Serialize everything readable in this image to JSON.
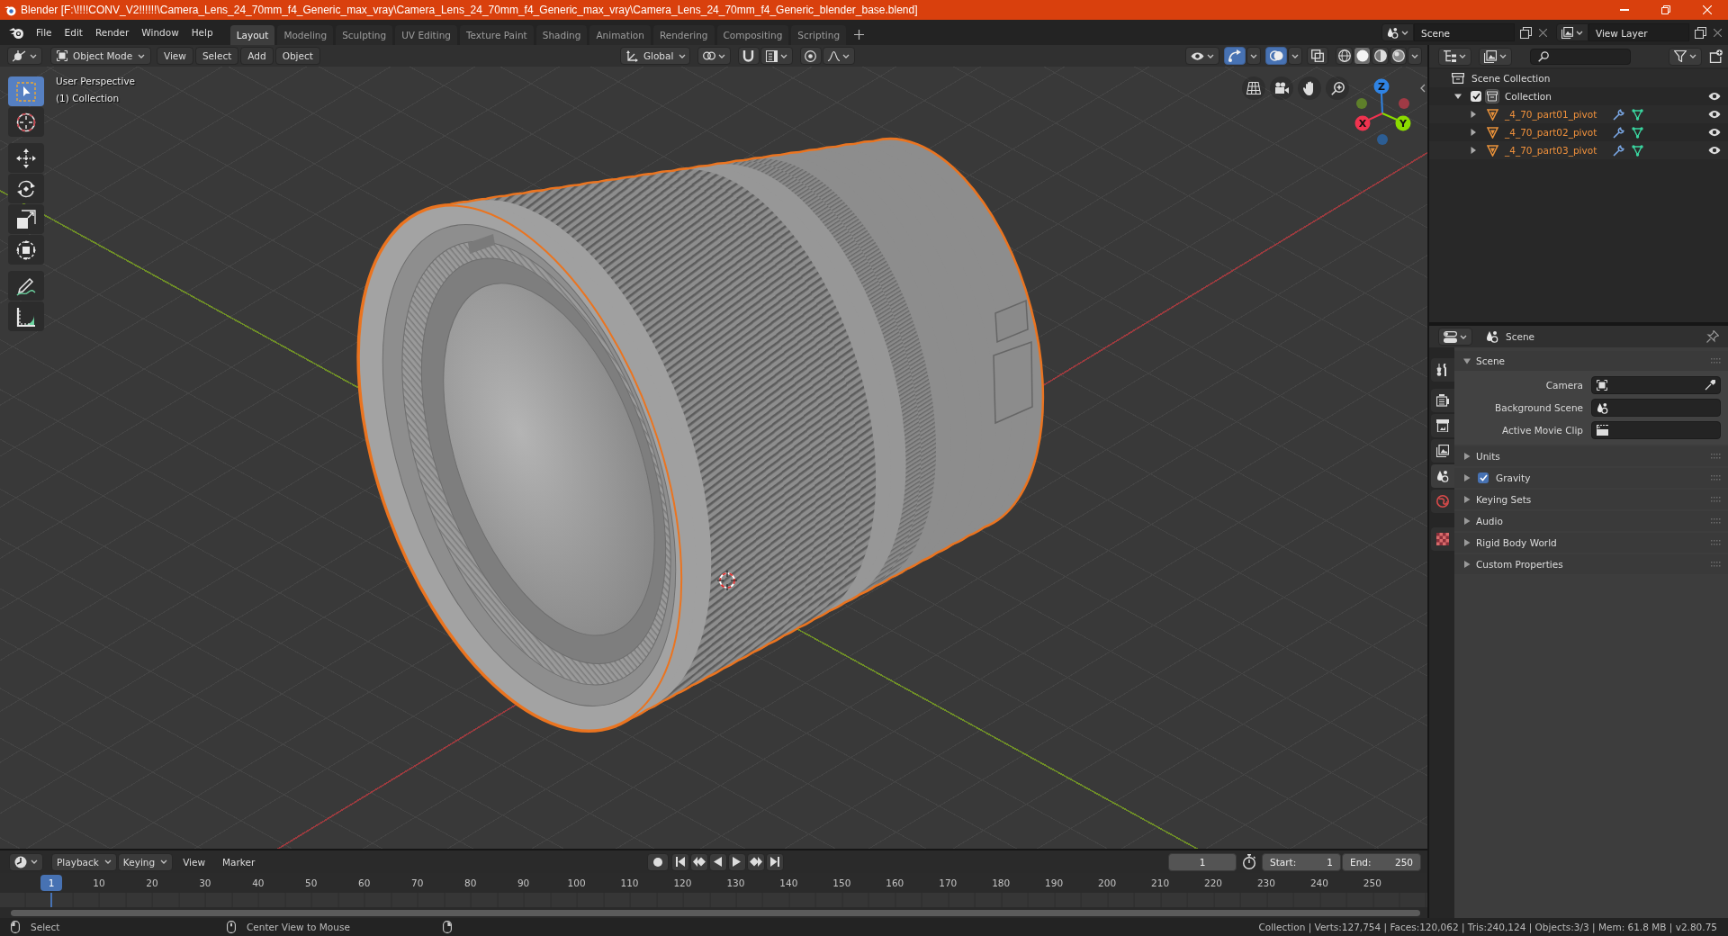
{
  "window": {
    "title": "Blender [F:\\!!!!CONV_V2!!!!!!\\Camera_Lens_24_70mm_f4_Generic_max_vray\\Camera_Lens_24_70mm_f4_Generic_max_vray\\Camera_Lens_24_70mm_f4_Generic_blender_base.blend]"
  },
  "menu": [
    "File",
    "Edit",
    "Render",
    "Window",
    "Help"
  ],
  "workspaces": [
    {
      "label": "Layout",
      "selected": true
    },
    {
      "label": "Modeling",
      "selected": false
    },
    {
      "label": "Sculpting",
      "selected": false
    },
    {
      "label": "UV Editing",
      "selected": false
    },
    {
      "label": "Texture Paint",
      "selected": false
    },
    {
      "label": "Shading",
      "selected": false
    },
    {
      "label": "Animation",
      "selected": false
    },
    {
      "label": "Rendering",
      "selected": false
    },
    {
      "label": "Compositing",
      "selected": false
    },
    {
      "label": "Scripting",
      "selected": false
    }
  ],
  "scene": {
    "label": "Scene"
  },
  "view_layer": {
    "label": "View Layer"
  },
  "viewport": {
    "header": {
      "mode": "Object Mode",
      "menus": [
        "View",
        "Select",
        "Add",
        "Object"
      ],
      "orientation": "Global",
      "toggles": [
        {
          "kind": "gizmos",
          "on": true
        },
        {
          "kind": "overlays",
          "on": true
        },
        {
          "kind": "xray",
          "on": false
        }
      ],
      "shading": [
        {
          "kind": "wireframe",
          "selected": false
        },
        {
          "kind": "solid",
          "selected": true
        },
        {
          "kind": "material",
          "selected": false
        },
        {
          "kind": "rendered",
          "selected": false
        }
      ]
    },
    "info": [
      "User Perspective",
      "(1) Collection"
    ],
    "tool_groups": [
      {
        "tools": [
          {
            "kind": "select_box",
            "selected": true
          },
          {
            "kind": "cursor",
            "selected": false
          }
        ]
      },
      {
        "tools": [
          {
            "kind": "move",
            "selected": false
          },
          {
            "kind": "rotate",
            "selected": false
          },
          {
            "kind": "scale",
            "selected": false
          },
          {
            "kind": "transform",
            "selected": false
          }
        ]
      },
      {
        "tools": [
          {
            "kind": "annotate",
            "selected": false
          },
          {
            "kind": "measure",
            "selected": false
          }
        ]
      }
    ],
    "axes": [
      {
        "kind": "z",
        "label": "Z"
      },
      {
        "kind": "x",
        "label": "X"
      },
      {
        "kind": "y",
        "label": "Y"
      }
    ]
  },
  "outliner": {
    "root": "Scene Collection",
    "collections": [
      {
        "label": "Collection",
        "checked": true,
        "expanded": true,
        "visible": true,
        "children": [
          {
            "label": "_4_70_part01_pivot",
            "expanded": false,
            "selected": true,
            "visible": true
          },
          {
            "label": "_4_70_part02_pivot",
            "expanded": false,
            "selected": true,
            "visible": true
          },
          {
            "label": "_4_70_part03_pivot",
            "expanded": false,
            "selected": true,
            "visible": true
          }
        ]
      }
    ]
  },
  "properties": {
    "context": "Scene",
    "tab_groups": [
      {
        "tabs": [
          {
            "kind": "tool",
            "selected": false
          }
        ]
      },
      {
        "tabs": [
          {
            "kind": "render",
            "selected": false
          },
          {
            "kind": "output",
            "selected": false
          },
          {
            "kind": "view_layer",
            "selected": false
          },
          {
            "kind": "scene",
            "selected": true
          },
          {
            "kind": "world",
            "selected": false
          }
        ]
      },
      {
        "tabs": [
          {
            "kind": "texture",
            "selected": false
          }
        ]
      }
    ],
    "panels": [
      {
        "kind": "plain",
        "title": "Scene",
        "expanded": true,
        "fields": [
          {
            "kind": "object",
            "label": "Camera"
          },
          {
            "kind": "scene",
            "label": "Background Scene"
          },
          {
            "kind": "clip",
            "label": "Active Movie Clip"
          }
        ]
      },
      {
        "kind": "plain",
        "title": "Units",
        "expanded": false
      },
      {
        "kind": "toggle",
        "title": "Gravity",
        "expanded": false,
        "checked": true
      },
      {
        "kind": "plain",
        "title": "Keying Sets",
        "expanded": false
      },
      {
        "kind": "plain",
        "title": "Audio",
        "expanded": false
      },
      {
        "kind": "plain",
        "title": "Rigid Body World",
        "expanded": false
      },
      {
        "kind": "plain",
        "title": "Custom Properties",
        "expanded": false
      }
    ]
  },
  "timeline": {
    "menus": [
      {
        "kind": "dropdown",
        "label": "Playback"
      },
      {
        "kind": "dropdown",
        "label": "Keying"
      },
      {
        "kind": "menu",
        "label": "View"
      },
      {
        "kind": "menu",
        "label": "Marker"
      }
    ],
    "current_frame": "1",
    "start_label": "Start:",
    "start": "1",
    "end_label": "End:",
    "end": "250",
    "playhead": "1",
    "ruler": [
      "10",
      "20",
      "30",
      "40",
      "50",
      "60",
      "70",
      "80",
      "90",
      "100",
      "110",
      "120",
      "130",
      "140",
      "150",
      "160",
      "170",
      "180",
      "190",
      "200",
      "210",
      "220",
      "230",
      "240",
      "250"
    ]
  },
  "status_bar": {
    "hints": [
      {
        "kind": "mouse_left",
        "label": "Select"
      },
      {
        "kind": "mouse_middle",
        "label": "Center View to Mouse"
      },
      {
        "kind": "mouse_right"
      }
    ],
    "stats": "Collection | Verts:127,754 | Faces:120,062 | Tris:240,124 | Objects:3/3 | Mem: 61.8 MB | v2.80.75"
  }
}
